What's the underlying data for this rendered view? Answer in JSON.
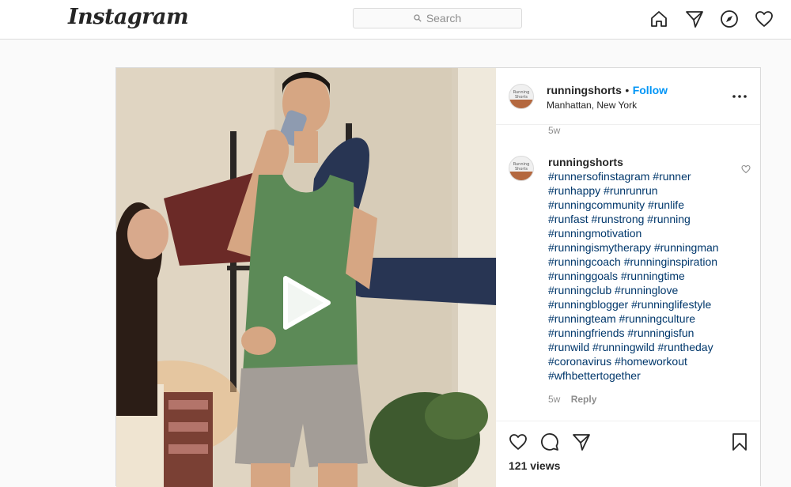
{
  "app": {
    "logo_text": "Instagram"
  },
  "search": {
    "placeholder": "Search"
  },
  "nav": {
    "icons": [
      "home-icon",
      "direct-message-icon",
      "explore-icon",
      "activity-heart-icon"
    ]
  },
  "post": {
    "username": "runningshorts",
    "separator": "•",
    "follow_label": "Follow",
    "location": "Manhattan, New York",
    "top_age": "5w",
    "avatar_text": "Running Shorts",
    "caption": {
      "username": "runningshorts",
      "hashtags": [
        "#runnersofinstagram #runner",
        "#runhappy #runrunrun",
        "#runningcommunity #runlife",
        "#runfast #runstrong #running",
        "#runningmotivation",
        "#runningismytherapy #runningman",
        "#runningcoach #runninginspiration",
        "#runninggoals #runningtime",
        "#runningclub #runninglove",
        "#runningblogger #runninglifestyle",
        "#runningteam #runningculture",
        "#runningfriends #runningisfun",
        "#runwild #runningwild #runtheday",
        "#coronavirus #homeworkout",
        "#wfhbettertogether"
      ],
      "age": "5w",
      "reply_label": "Reply"
    },
    "views": "121 views"
  },
  "colors": {
    "link_blue": "#0095f6",
    "hashtag_blue": "#00376b",
    "muted": "#8e8e8e",
    "border": "#dbdbdb"
  }
}
